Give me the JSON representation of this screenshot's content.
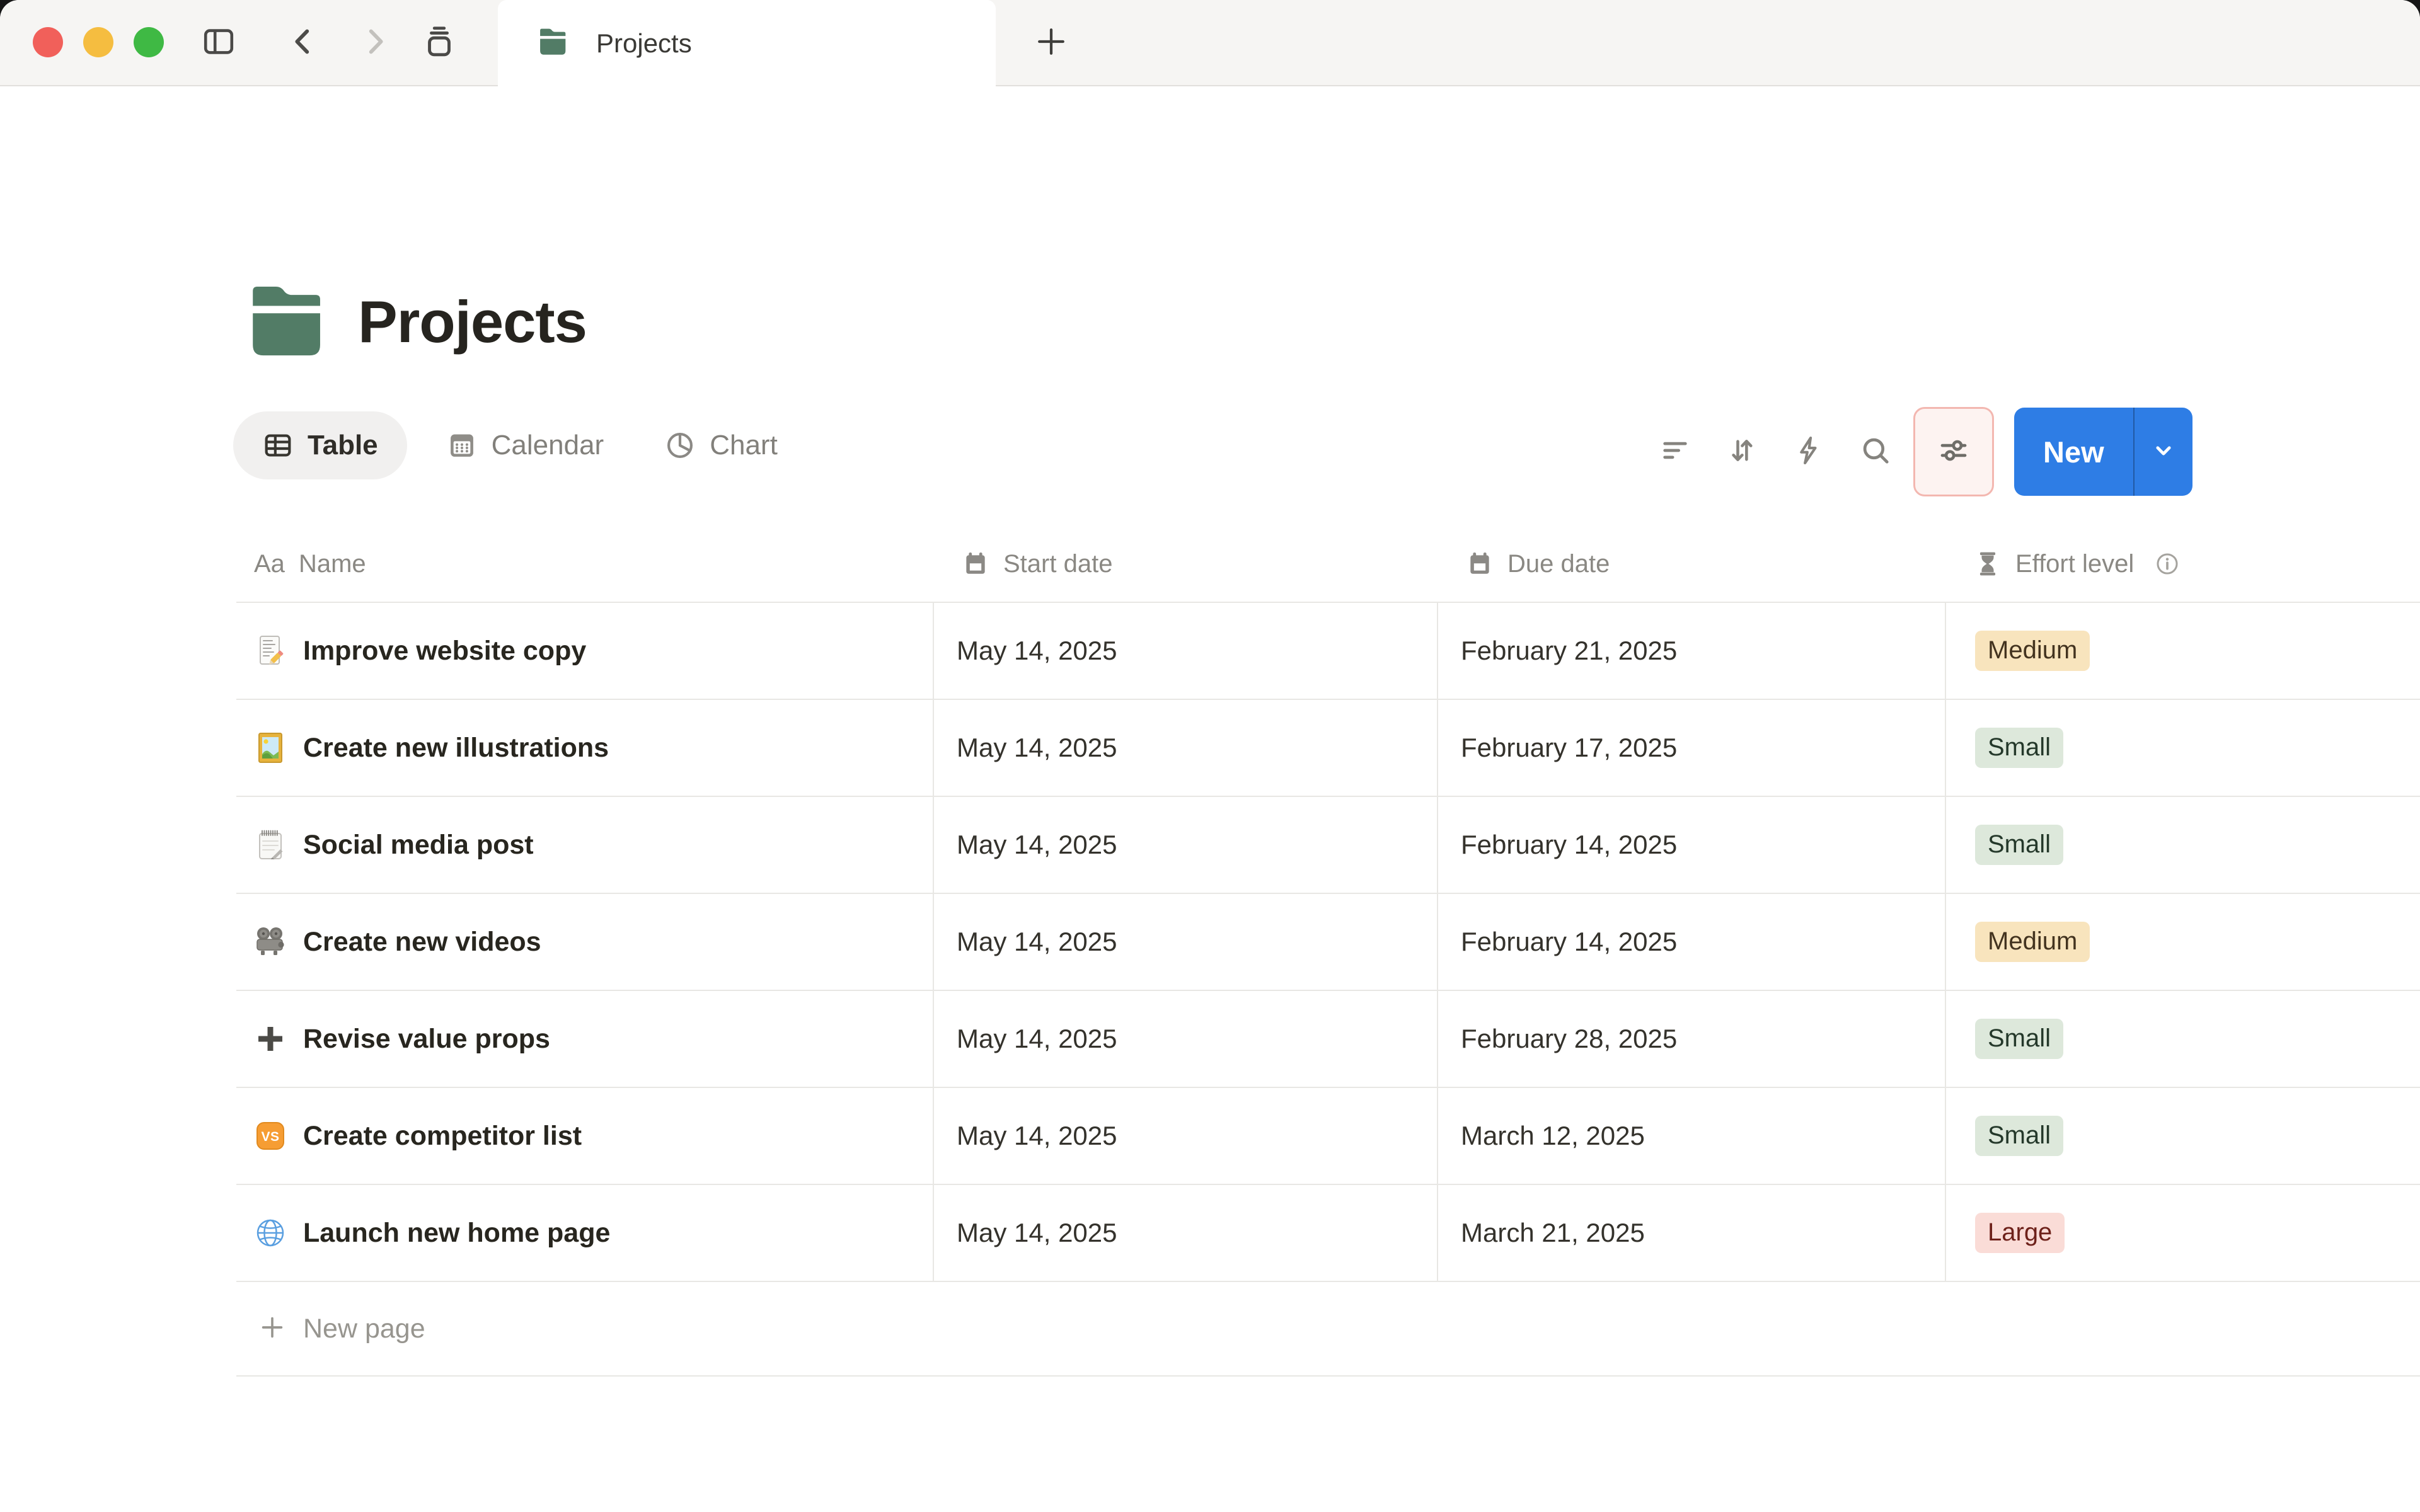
{
  "window": {
    "tab_title": "Projects",
    "icons": [
      "sidebar-toggle-icon",
      "back-icon",
      "forward-icon",
      "tab-stack-icon",
      "new-tab-plus-icon",
      "folder-icon"
    ]
  },
  "page": {
    "title": "Projects",
    "icon": "folder-icon"
  },
  "views": [
    {
      "label": "Table",
      "icon": "table-view-icon",
      "active": true
    },
    {
      "label": "Calendar",
      "icon": "calendar-view-icon",
      "active": false
    },
    {
      "label": "Chart",
      "icon": "pie-chart-icon",
      "active": false
    }
  ],
  "toolbar": {
    "icons": [
      "filter-icon",
      "sort-icon",
      "automation-zap-icon",
      "search-icon",
      "settings-sliders-icon"
    ],
    "highlighted_icon": "settings-sliders-icon",
    "new_label": "New",
    "new_menu_icon": "chevron-down-icon"
  },
  "table": {
    "columns": [
      {
        "label": "Name",
        "icon": "text-Aa-icon",
        "icon_glyph": "Aa"
      },
      {
        "label": "Start date",
        "icon": "calendar-icon"
      },
      {
        "label": "Due date",
        "icon": "calendar-icon"
      },
      {
        "label": "Effort level",
        "icon": "hourglass-icon",
        "info_icon": true
      }
    ],
    "rows": [
      {
        "icon": "memo-icon",
        "name": "Improve website copy",
        "start": "May 14, 2025",
        "due": "February 21, 2025",
        "effort": "Medium",
        "effort_color": "yellow"
      },
      {
        "icon": "framed-picture-icon",
        "name": "Create new illustrations",
        "start": "May 14, 2025",
        "due": "February 17, 2025",
        "effort": "Small",
        "effort_color": "green"
      },
      {
        "icon": "spiral-notepad-icon",
        "name": "Social media post",
        "start": "May 14, 2025",
        "due": "February 14, 2025",
        "effort": "Small",
        "effort_color": "green"
      },
      {
        "icon": "film-projector-icon",
        "name": "Create new videos",
        "start": "May 14, 2025",
        "due": "February 14, 2025",
        "effort": "Medium",
        "effort_color": "yellow"
      },
      {
        "icon": "heavy-plus-icon",
        "name": "Revise value props",
        "start": "May 14, 2025",
        "due": "February 28, 2025",
        "effort": "Small",
        "effort_color": "green"
      },
      {
        "icon": "vs-badge-icon",
        "name": "Create competitor list",
        "start": "May 14, 2025",
        "due": "March 12, 2025",
        "effort": "Small",
        "effort_color": "green"
      },
      {
        "icon": "globe-icon",
        "name": "Launch new home page",
        "start": "May 14, 2025",
        "due": "March 21, 2025",
        "effort": "Large",
        "effort_color": "red"
      }
    ],
    "new_page_label": "New page"
  },
  "colors": {
    "accent": "#2e7de5",
    "folder_green": "#527c66",
    "tabbar_bg": "#f6f5f3",
    "tabbar_border": "#e2e0dd",
    "pill_bg": "#f1f0ef",
    "divider": "#e8e7e4",
    "highlight_bg": "#fdf3f1",
    "highlight_border": "#f3b7b0",
    "badge_yellow_bg": "#f8e4bd",
    "badge_yellow_text": "#43331f",
    "badge_green_bg": "#dde8db",
    "badge_green_text": "#24382a",
    "badge_red_bg": "#fadcd7",
    "badge_red_text": "#6e211a",
    "traffic_red": "#f1605a",
    "traffic_yellow": "#f5bd40",
    "traffic_green": "#3fb944"
  }
}
